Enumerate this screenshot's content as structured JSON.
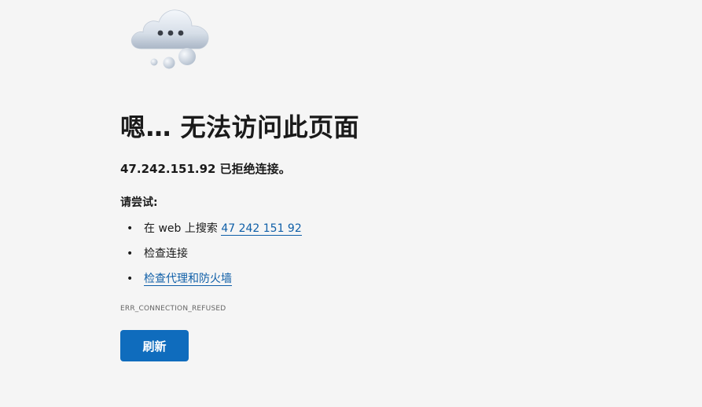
{
  "error_page": {
    "illustration_icon": "cloud-with-ellipsis-icon",
    "title": "嗯… 无法访问此页面",
    "message": "47.242.151.92 已拒绝连接。",
    "try_label": "请尝试:",
    "suggestions": [
      {
        "bullet": "•",
        "prefix": "在 web 上搜索 ",
        "link_text": "47 242 151 92"
      },
      {
        "bullet": "•",
        "text": "检查连接"
      },
      {
        "bullet": "•",
        "link_text": "检查代理和防火墙"
      }
    ],
    "error_code": "ERR_CONNECTION_REFUSED",
    "refresh_label": "刷新"
  },
  "colors": {
    "background": "#f5f5f5",
    "link": "#0f5fa8",
    "button": "#0f6cbd",
    "button_text": "#ffffff"
  }
}
